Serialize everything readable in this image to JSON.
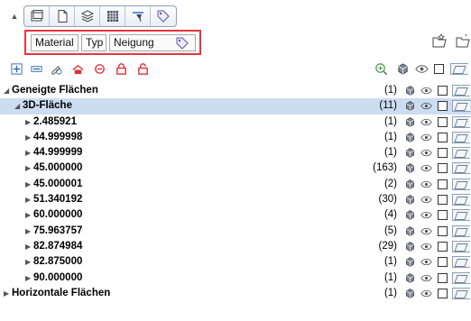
{
  "tabs": [
    {
      "icon": "window-layout-icon"
    },
    {
      "icon": "document-icon"
    },
    {
      "icon": "layers-icon"
    },
    {
      "icon": "grid-icon"
    },
    {
      "icon": "roof-slope-icon"
    },
    {
      "icon": "tag-icon"
    }
  ],
  "filter": {
    "chips": [
      "Material",
      "Typ",
      "Neigung"
    ]
  },
  "tree": {
    "rows": [
      {
        "label": "Geneigte Flächen",
        "count": "(1)",
        "level": 0,
        "expanded": true,
        "selected": false
      },
      {
        "label": "3D-Fläche",
        "count": "(11)",
        "level": 1,
        "expanded": true,
        "selected": true
      },
      {
        "label": "2.485921",
        "count": "(1)",
        "level": 2,
        "expanded": false,
        "selected": false
      },
      {
        "label": "44.999998",
        "count": "(1)",
        "level": 2,
        "expanded": false,
        "selected": false
      },
      {
        "label": "44.999999",
        "count": "(1)",
        "level": 2,
        "expanded": false,
        "selected": false
      },
      {
        "label": "45.000000",
        "count": "(163)",
        "level": 2,
        "expanded": false,
        "selected": false
      },
      {
        "label": "45.000001",
        "count": "(2)",
        "level": 2,
        "expanded": false,
        "selected": false
      },
      {
        "label": "51.340192",
        "count": "(30)",
        "level": 2,
        "expanded": false,
        "selected": false
      },
      {
        "label": "60.000000",
        "count": "(4)",
        "level": 2,
        "expanded": false,
        "selected": false
      },
      {
        "label": "75.963757",
        "count": "(5)",
        "level": 2,
        "expanded": false,
        "selected": false
      },
      {
        "label": "82.874984",
        "count": "(29)",
        "level": 2,
        "expanded": false,
        "selected": false
      },
      {
        "label": "82.875000",
        "count": "(1)",
        "level": 2,
        "expanded": false,
        "selected": false
      },
      {
        "label": "90.000000",
        "count": "(1)",
        "level": 2,
        "expanded": false,
        "selected": false
      },
      {
        "label": "Horizontale Flächen",
        "count": "(1)",
        "level": 0,
        "expanded": false,
        "selected": false
      }
    ]
  },
  "colors": {
    "highlight_border": "#e8343b",
    "selection": "#ccdcf1",
    "accent_red": "#e0353b",
    "accent_blue": "#2f6fb3",
    "accent_green": "#3a9a3a"
  }
}
